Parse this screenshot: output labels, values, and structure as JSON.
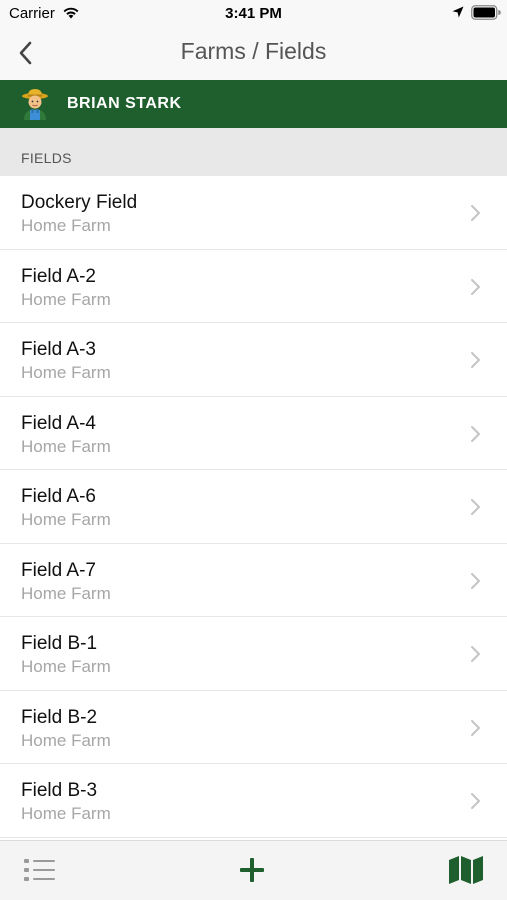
{
  "status_bar": {
    "carrier": "Carrier",
    "time": "3:41 PM"
  },
  "nav": {
    "title": "Farms / Fields",
    "back_icon": "chevron-left-icon"
  },
  "farmer": {
    "name": "BRIAN STARK",
    "avatar_icon": "farmer-avatar-icon"
  },
  "section": {
    "label": "FIELDS"
  },
  "fields": [
    {
      "name": "Dockery Field",
      "farm": "Home Farm"
    },
    {
      "name": "Field A-2",
      "farm": "Home Farm"
    },
    {
      "name": "Field A-3",
      "farm": "Home Farm"
    },
    {
      "name": "Field A-4",
      "farm": "Home Farm"
    },
    {
      "name": "Field A-6",
      "farm": "Home Farm"
    },
    {
      "name": "Field A-7",
      "farm": "Home Farm"
    },
    {
      "name": "Field B-1",
      "farm": "Home Farm"
    },
    {
      "name": "Field B-2",
      "farm": "Home Farm"
    },
    {
      "name": "Field B-3",
      "farm": "Home Farm"
    }
  ],
  "tab_bar": {
    "items": [
      "list-icon",
      "add-icon",
      "map-icon"
    ]
  },
  "colors": {
    "brand_green": "#1f5f2d",
    "section_bg": "#e8e8e8",
    "subtitle_gray": "#a6a6a6"
  }
}
